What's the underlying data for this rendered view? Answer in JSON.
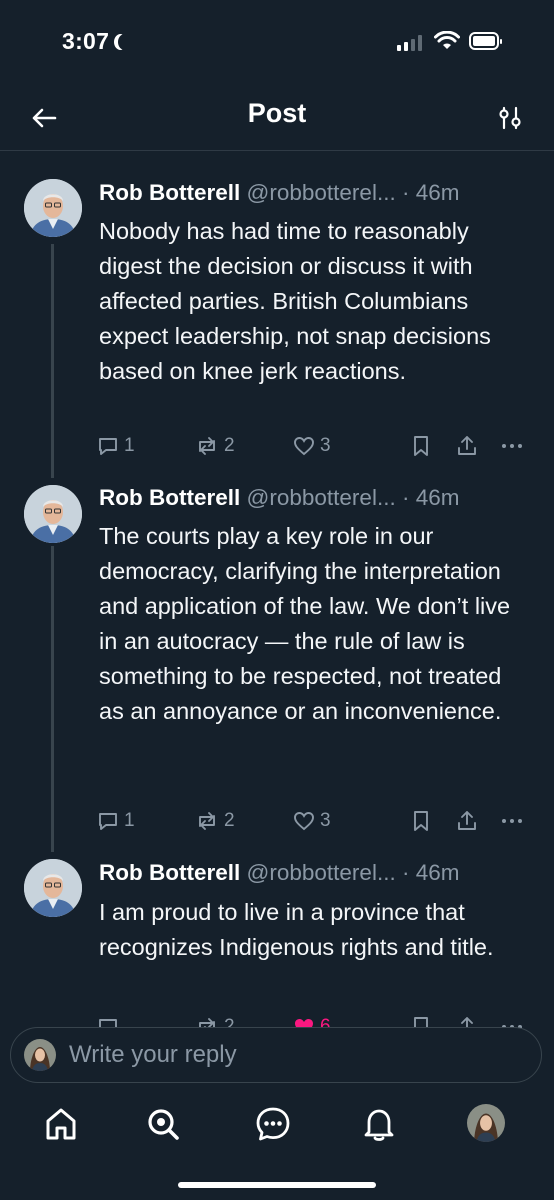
{
  "status_bar": {
    "time": "3:07"
  },
  "header": {
    "title": "Post"
  },
  "colors": {
    "background": "#15202b",
    "muted": "#8b98a5",
    "like_active": "#f91880",
    "divider": "#2f3a45"
  },
  "posts": [
    {
      "name": "Rob Botterell",
      "handle": "@robbotterel...",
      "separator": "·",
      "time": "46m",
      "text": "Nobody has had time to reasonably digest the decision or discuss it with affected parties. British Columbians expect leadership, not snap decisions based on knee jerk reactions.",
      "replies": "1",
      "reposts": "2",
      "likes": "3"
    },
    {
      "name": "Rob Botterell",
      "handle": "@robbotterel...",
      "separator": "·",
      "time": "46m",
      "text": "The courts play a key role in our democracy, clarifying the interpretation and application of the law. We don’t live in an autocracy — the rule of law is something to be respected, not treated as an annoyance or an inconvenience.",
      "replies": "1",
      "reposts": "2",
      "likes": "3"
    },
    {
      "name": "Rob Botterell",
      "handle": "@robbotterel...",
      "separator": "·",
      "time": "46m",
      "text": "I am proud to live in a province that recognizes Indigenous rights and title.",
      "replies": "",
      "reposts": "2",
      "likes": "6"
    }
  ],
  "reply_box": {
    "placeholder": "Write your reply"
  },
  "nav": [
    "home-icon",
    "search-icon",
    "messages-icon",
    "notifications-icon",
    "profile-avatar"
  ]
}
